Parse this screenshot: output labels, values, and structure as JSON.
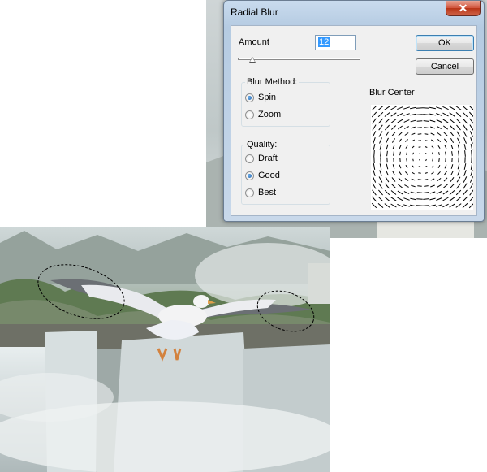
{
  "dialog": {
    "title": "Radial Blur",
    "close_glyph": "✕",
    "amount_label": "Amount",
    "amount_value": "12",
    "amount_fraction": 0.12,
    "ok_label": "OK",
    "cancel_label": "Cancel",
    "blur_method": {
      "title": "Blur Method:",
      "options": [
        "Spin",
        "Zoom"
      ],
      "selected": "Spin"
    },
    "quality": {
      "title": "Quality:",
      "options": [
        "Draft",
        "Good",
        "Best"
      ],
      "selected": "Good"
    },
    "blur_center_label": "Blur Center"
  },
  "canvas": {
    "subject": "seagull over waterfall",
    "selection": "two lasso selections around wing tips"
  }
}
